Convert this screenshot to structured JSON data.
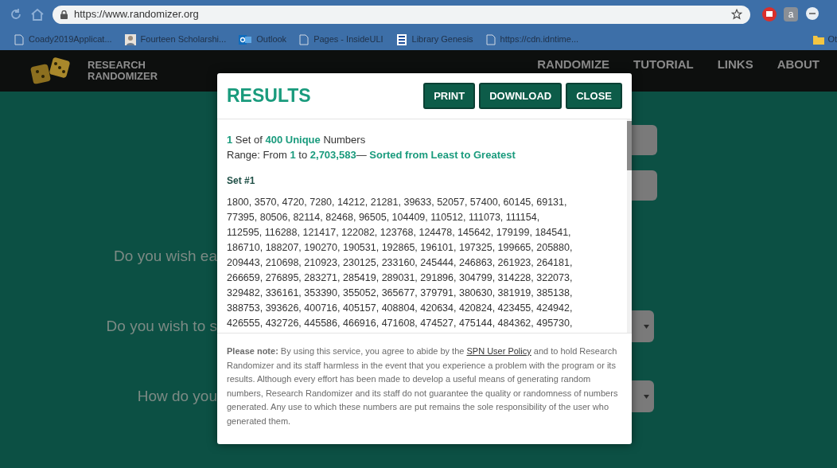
{
  "browser": {
    "url": "https://www.randomizer.org",
    "bookmarks": [
      {
        "label": "Coady2019Applicat...",
        "kind": "page"
      },
      {
        "label": "Fourteen Scholarshi...",
        "kind": "person"
      },
      {
        "label": "Outlook",
        "kind": "mail"
      },
      {
        "label": "Pages - InsideULI",
        "kind": "page"
      },
      {
        "label": "Library Genesis",
        "kind": "book"
      },
      {
        "label": "https://cdn.idntime...",
        "kind": "page"
      }
    ],
    "bookmarks_overflow": {
      "label": "Ot",
      "kind": "folder"
    },
    "extensions": [
      {
        "kind": "red"
      },
      {
        "kind": "letter",
        "label": "a"
      },
      {
        "kind": "bubble"
      }
    ]
  },
  "site": {
    "logo_lines": [
      "RESEARCH",
      "RANDOMIZER"
    ],
    "nav": [
      {
        "label": "RANDOMIZE"
      },
      {
        "label": "TUTORIAL"
      },
      {
        "label": "LINKS"
      },
      {
        "label": "ABOUT"
      }
    ],
    "form_labels": [
      "Do you wish ea",
      "Do you wish to s",
      "How do you"
    ],
    "fields": [
      {
        "kind": "input"
      },
      {
        "kind": "input"
      },
      {
        "kind": "select"
      },
      {
        "kind": "select"
      }
    ]
  },
  "modal": {
    "title": "RESULTS",
    "buttons": [
      "PRINT",
      "DOWNLOAD",
      "CLOSE"
    ],
    "summary": [
      "**1** Set of **400 Unique** Numbers",
      "Range: From **1** to **2,703,583**— **Sorted from Least to Greatest**"
    ],
    "set_title": "Set #1",
    "number_lines": [
      "1800, 3570, 4720, 7280, 14212, 21281, 39633, 52057, 57400, 60145, 69131,",
      "77395, 80506, 82114, 82468, 96505, 104409, 110512, 111073, 111154,",
      "112595, 116288, 121417, 122082, 123768, 124478, 145642, 179199, 184541,",
      "186710, 188207, 190270, 190531, 192865, 196101, 197325, 199665, 205880,",
      "209443, 210698, 210923, 230125, 233160, 245444, 246863, 261923, 264181,",
      "266659, 276895, 283271, 285419, 289031, 291896, 304799, 314228, 322073,",
      "329482, 336161, 353390, 355052, 365677, 379791, 380630, 381919, 385138,",
      "388753, 393626, 400716, 405157, 408804, 420634, 420824, 423455, 424942,",
      "426555, 432726, 445586, 466916, 471608, 474527, 475144, 484362, 495730,"
    ],
    "note": {
      "before": "**Please note:** By using this service, you agree to abide by the",
      "link": "SPN User Policy",
      "after": "and to hold Research Randomizer and its staff harmless in the event that you experience a problem with the program or its results. Although every effort has been made to develop a useful means of generating random numbers, Research Randomizer and its staff do not guarantee the quality or randomness of numbers generated. Any use to which these numbers are put remains the sole responsibility of the user who generated them."
    }
  }
}
